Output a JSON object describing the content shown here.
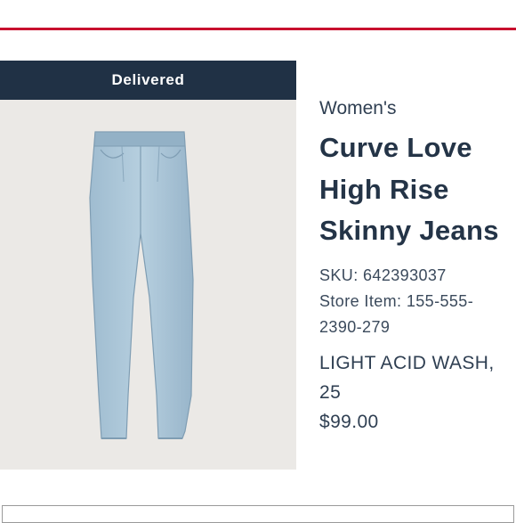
{
  "order_card": {
    "status": "Delivered",
    "category": "Women's",
    "title": "Curve Love High Rise Skinny Jeans",
    "sku": "SKU: 642393037",
    "store_item": "Store Item: 155-555-2390-279",
    "variant": "LIGHT ACID WASH, 25",
    "price": "$99.00"
  },
  "colors": {
    "accent_rule": "#c8102e",
    "banner": "#203145",
    "denim": "#a9c4d6"
  }
}
